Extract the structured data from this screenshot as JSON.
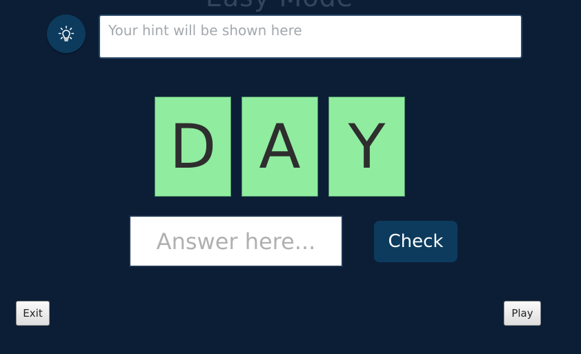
{
  "header": {
    "mode_title": "Easy Mode"
  },
  "hint": {
    "icon": "lightbulb-icon",
    "placeholder": "Your hint will be shown here"
  },
  "tiles": [
    {
      "letter": "D"
    },
    {
      "letter": "A"
    },
    {
      "letter": "Y"
    }
  ],
  "answer": {
    "placeholder": "Answer here...",
    "value": ""
  },
  "buttons": {
    "check": "Check",
    "exit": "Exit",
    "play": "Play"
  },
  "colors": {
    "background": "#0c1e36",
    "accent": "#0c3b5d",
    "tile": "#90ec9f"
  }
}
